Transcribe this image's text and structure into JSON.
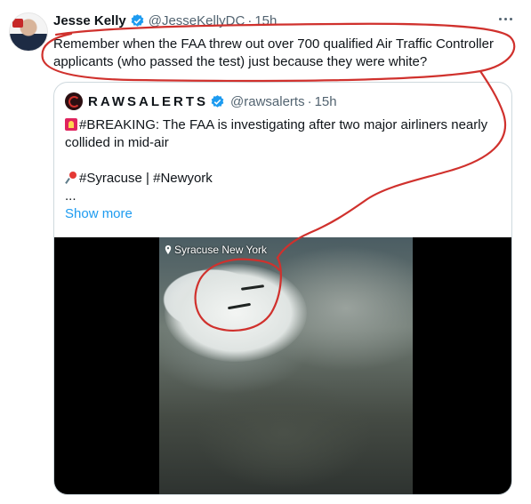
{
  "tweet": {
    "author_name": "Jesse Kelly",
    "author_handle": "@JesseKellyDC",
    "separator": "·",
    "time": "15h",
    "text": "Remember when the FAA threw out over 700 qualified Air Traffic Controller applicants (who passed the test) just because they were white?"
  },
  "quote": {
    "author_name": "RAWSALERTS",
    "author_handle": "@rawsalerts",
    "separator": "·",
    "time": "15h",
    "line1": "#BREAKING: The FAA is investigating after two major airliners nearly collided in mid-air",
    "line2": "#Syracuse | #Newyork",
    "ellipsis": "...",
    "show_more": "Show more",
    "media_location": "Syracuse New York"
  },
  "colors": {
    "accent": "#1d9bf0",
    "annotation": "#d0312d",
    "muted": "#536471"
  },
  "icons": {
    "verified": "verified-badge-icon",
    "more": "more-options-icon",
    "location": "location-pin-icon"
  }
}
